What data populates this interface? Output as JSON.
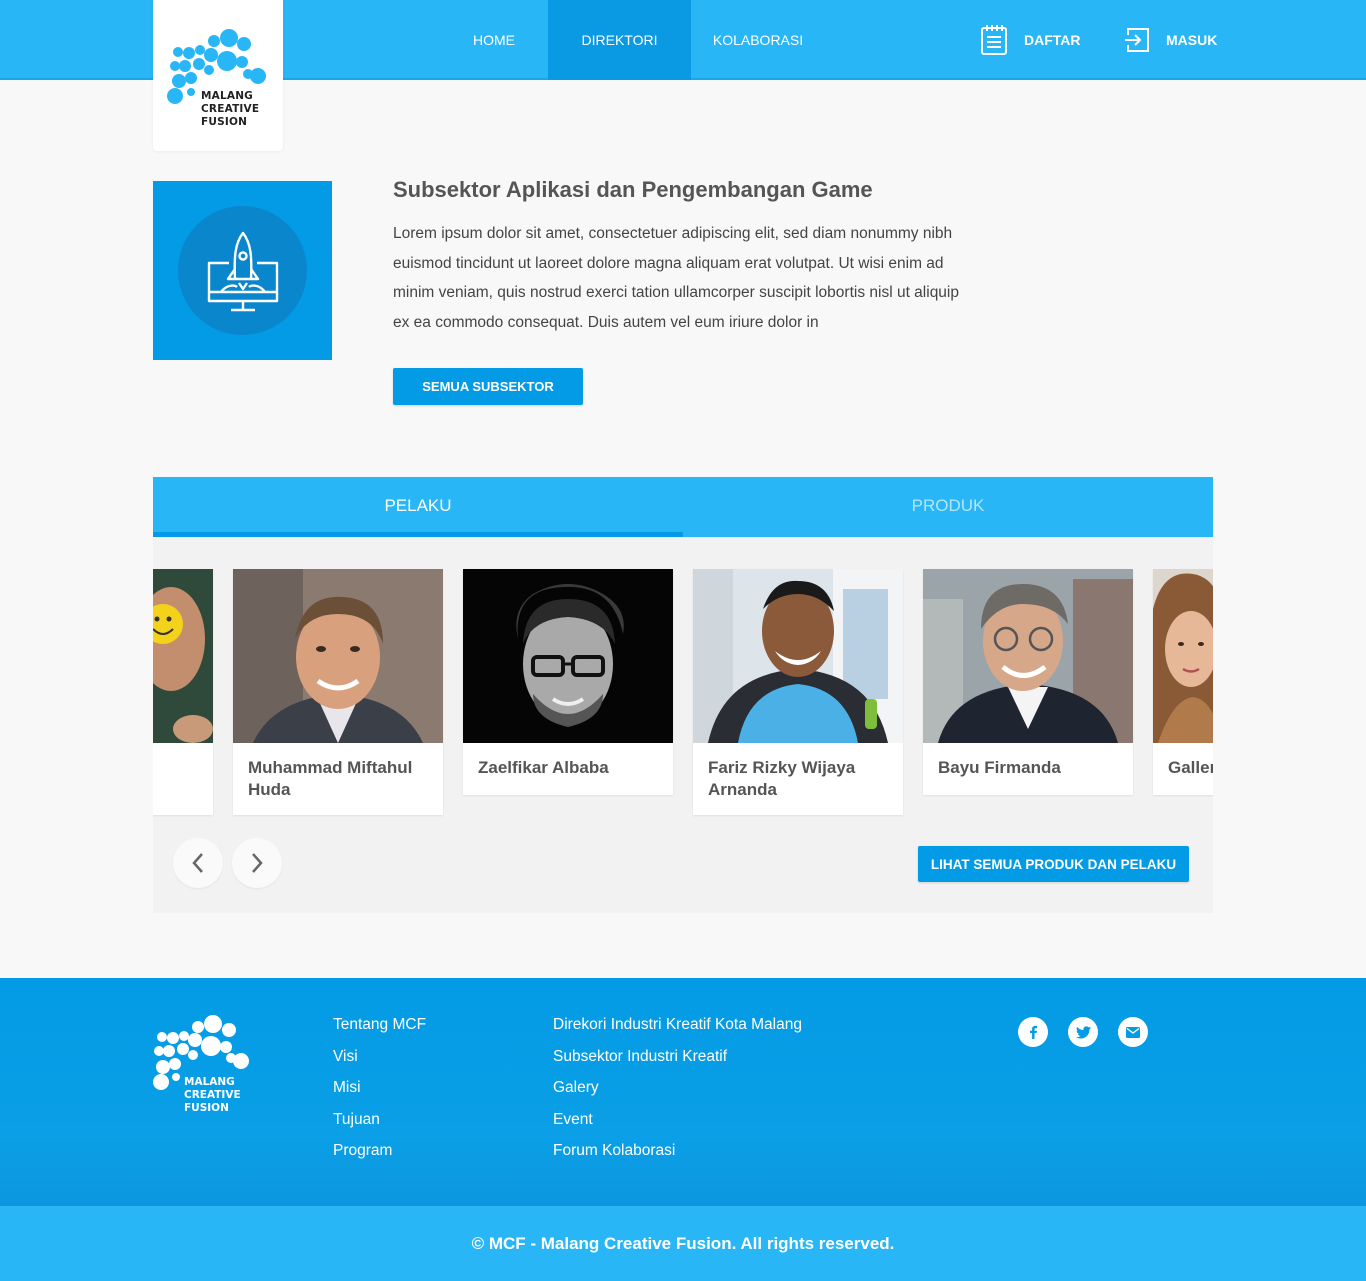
{
  "brand": {
    "logo_lines": [
      "MALANG",
      "CREATIVE",
      "FUSION"
    ],
    "primary_color": "#29b6f6",
    "accent_color": "#039be5"
  },
  "nav": {
    "items": [
      {
        "label": "HOME",
        "active": false
      },
      {
        "label": "DIREKTORI",
        "active": true
      },
      {
        "label": "KOLABORASI",
        "active": false
      }
    ],
    "daftar": {
      "label": "DAFTAR",
      "icon": "calendar-list-icon"
    },
    "masuk": {
      "label": "MASUK",
      "icon": "login-icon"
    }
  },
  "subsektor": {
    "icon": "rocket-monitor-icon",
    "title": "Subsektor Aplikasi dan Pengembangan Game",
    "description": "Lorem ipsum dolor sit amet, consectetuer adipiscing elit, sed diam nonummy nibh euismod tincidunt ut laoreet dolore magna aliquam erat volutpat. Ut wisi enim ad minim veniam, quis nostrud exerci tation ullamcorper suscipit lobortis nisl ut aliquip ex ea commodo consequat. Duis autem vel eum iriure dolor in",
    "button_label": "SEMUA SUBSEKTOR"
  },
  "tabs": [
    {
      "label": "PELAKU",
      "active": true
    },
    {
      "label": "PRODUK",
      "active": false
    }
  ],
  "pelaku": [
    {
      "name": ""
    },
    {
      "name": "Muhammad Miftahul Huda"
    },
    {
      "name": "Zaelfikar Albaba"
    },
    {
      "name": "Fariz Rizky Wijaya Arnanda"
    },
    {
      "name": "Bayu Firmanda"
    },
    {
      "name": "Galler"
    }
  ],
  "carousel": {
    "prev_icon": "chevron-left-icon",
    "next_icon": "chevron-right-icon",
    "all_button_label": "LIHAT SEMUA PRODUK DAN PELAKU"
  },
  "footer": {
    "col1": [
      "Tentang MCF",
      "Visi",
      "Misi",
      "Tujuan",
      "Program"
    ],
    "col2": [
      "Direkori Industri Kreatif Kota Malang",
      "Subsektor Industri Kreatif",
      "Galery",
      "Event",
      "Forum Kolaborasi"
    ],
    "social": [
      "facebook-icon",
      "twitter-icon",
      "email-icon"
    ],
    "copyright": "© MCF - Malang Creative Fusion. All rights reserved."
  }
}
